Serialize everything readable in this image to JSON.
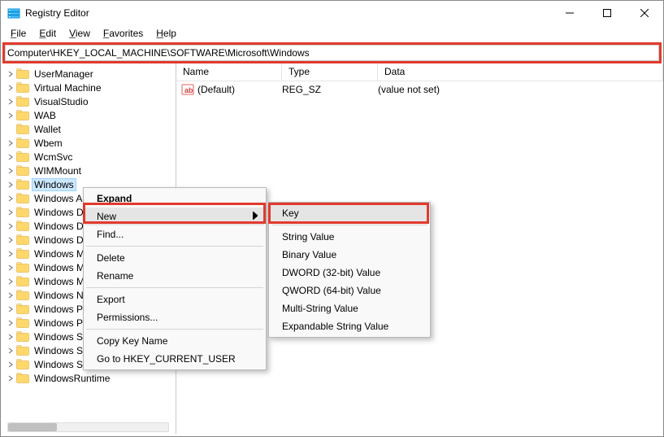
{
  "title": "Registry Editor",
  "menubar": [
    "File",
    "Edit",
    "View",
    "Favorites",
    "Help"
  ],
  "address": "Computer\\HKEY_LOCAL_MACHINE\\SOFTWARE\\Microsoft\\Windows",
  "tree_items": [
    {
      "exp": true,
      "label": "UserManager"
    },
    {
      "exp": true,
      "label": "Virtual Machine"
    },
    {
      "exp": true,
      "label": "VisualStudio"
    },
    {
      "exp": true,
      "label": "WAB"
    },
    {
      "exp": false,
      "label": "Wallet"
    },
    {
      "exp": true,
      "label": "Wbem"
    },
    {
      "exp": true,
      "label": "WcmSvc"
    },
    {
      "exp": true,
      "label": "WIMMount"
    },
    {
      "exp": true,
      "label": "Windows",
      "selected": true
    },
    {
      "exp": true,
      "label": "Windows Advanced Threat Protection"
    },
    {
      "exp": true,
      "label": "Windows Defender"
    },
    {
      "exp": true,
      "label": "Windows Defender Security Center"
    },
    {
      "exp": true,
      "label": "Windows Desktop Search"
    },
    {
      "exp": true,
      "label": "Windows Mail"
    },
    {
      "exp": true,
      "label": "Windows Media Foundation"
    },
    {
      "exp": true,
      "label": "Windows Media Player NSS"
    },
    {
      "exp": true,
      "label": "Windows NT"
    },
    {
      "exp": true,
      "label": "Windows Photo Viewer"
    },
    {
      "exp": true,
      "label": "Windows Portable Devices"
    },
    {
      "exp": true,
      "label": "Windows Script Host"
    },
    {
      "exp": true,
      "label": "Windows Search"
    },
    {
      "exp": true,
      "label": "Windows Security Health"
    },
    {
      "exp": true,
      "label": "WindowsRuntime"
    }
  ],
  "vals_header": {
    "name": "Name",
    "type": "Type",
    "data": "Data"
  },
  "vals_rows": [
    {
      "name": "(Default)",
      "type": "REG_SZ",
      "data": "(value not set)"
    }
  ],
  "ctx_main": [
    {
      "label": "Expand",
      "bold": true
    },
    {
      "label": "New",
      "hover": true,
      "sub": true
    },
    {
      "label": "Find..."
    },
    {
      "sep": true
    },
    {
      "label": "Delete"
    },
    {
      "label": "Rename"
    },
    {
      "sep": true
    },
    {
      "label": "Export"
    },
    {
      "label": "Permissions..."
    },
    {
      "sep": true
    },
    {
      "label": "Copy Key Name"
    },
    {
      "label": "Go to HKEY_CURRENT_USER"
    }
  ],
  "ctx_sub": [
    {
      "label": "Key",
      "hover": true
    },
    {
      "sep": true
    },
    {
      "label": "String Value"
    },
    {
      "label": "Binary Value"
    },
    {
      "label": "DWORD (32-bit) Value"
    },
    {
      "label": "QWORD (64-bit) Value"
    },
    {
      "label": "Multi-String Value"
    },
    {
      "label": "Expandable String Value"
    }
  ]
}
